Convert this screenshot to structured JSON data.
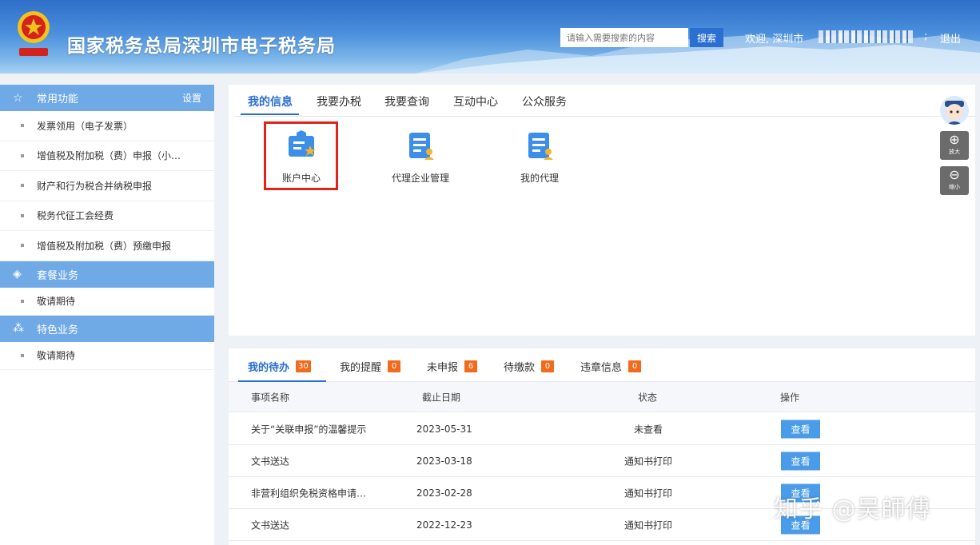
{
  "header": {
    "title": "国家税务总局深圳市电子税务局",
    "search_placeholder": "请输入需要搜索的内容",
    "search_label": "搜索",
    "welcome": "欢迎, 深圳市",
    "separator": ";",
    "logout_label": "退出"
  },
  "sidebar": {
    "groups": [
      {
        "title": "常用功能",
        "icon": "star-icon",
        "action": "设置",
        "items": [
          "发票领用（电子发票）",
          "增值税及附加税（费）申报（小…",
          "财产和行为税合并纳税申报",
          "税务代征工会经费",
          "增值税及附加税（费）预缴申报"
        ]
      },
      {
        "title": "套餐业务",
        "icon": "layers-icon",
        "items": [
          "敬请期待"
        ]
      },
      {
        "title": "特色业务",
        "icon": "grid-icon",
        "items": [
          "敬请期待"
        ]
      }
    ]
  },
  "main_tabs": [
    "我的信息",
    "我要办税",
    "我要查询",
    "互动中心",
    "公众服务"
  ],
  "apps": [
    {
      "label": "账户中心",
      "icon": "account-center-icon"
    },
    {
      "label": "代理企业管理",
      "icon": "agent-enterprise-icon"
    },
    {
      "label": "我的代理",
      "icon": "my-agent-icon"
    }
  ],
  "tools": {
    "zoom_in": "放大",
    "zoom_out": "缩小"
  },
  "todo_tabs": [
    {
      "label": "我的待办",
      "count": "30"
    },
    {
      "label": "我的提醒",
      "count": "0"
    },
    {
      "label": "未申报",
      "count": "6"
    },
    {
      "label": "待缴款",
      "count": "0"
    },
    {
      "label": "违章信息",
      "count": "0"
    }
  ],
  "table": {
    "headers": [
      "事项名称",
      "截止日期",
      "状态",
      "操作"
    ],
    "rows": [
      {
        "name": "关于“关联申报”的温馨提示",
        "date": "2023-05-31",
        "status": "未查看",
        "action": "查看"
      },
      {
        "name": "文书送达",
        "date": "2023-03-18",
        "status": "通知书打印",
        "action": "查看"
      },
      {
        "name": "非营利组织免税资格申请…",
        "date": "2023-02-28",
        "status": "通知书打印",
        "action": "查看"
      },
      {
        "name": "文书送达",
        "date": "2022-12-23",
        "status": "通知书打印",
        "action": "查看"
      }
    ]
  },
  "watermark": "知乎 @吴師傅",
  "colors": {
    "primary": "#2a6fd1",
    "sidebar_head": "#6fa9e6",
    "badge": "#f26a1b",
    "highlight": "#e0241b"
  }
}
